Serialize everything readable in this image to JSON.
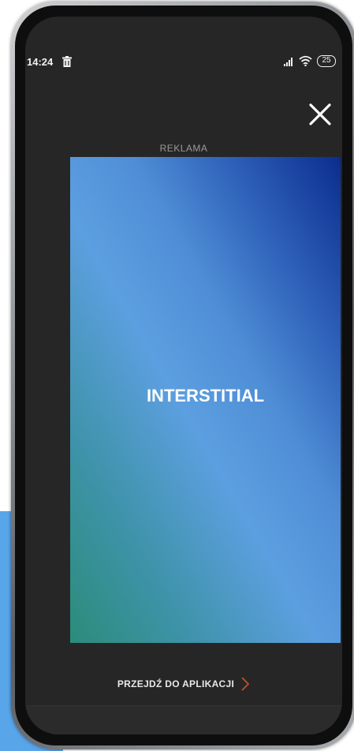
{
  "status_bar": {
    "time": "14:24",
    "battery": "25",
    "icons": [
      "trash-icon",
      "signal-icon",
      "wifi-icon",
      "battery-icon"
    ]
  },
  "ad": {
    "label": "REKLAMA",
    "banner_text": "INTERSTITIAL",
    "close_icon": "close-icon"
  },
  "footer": {
    "go_to_app_label": "PRZEJDŹ DO APLIKACJI",
    "chevron_color": "#c0502a"
  },
  "colors": {
    "screen_bg": "#262626",
    "accent_bg": "#59a5ea"
  }
}
